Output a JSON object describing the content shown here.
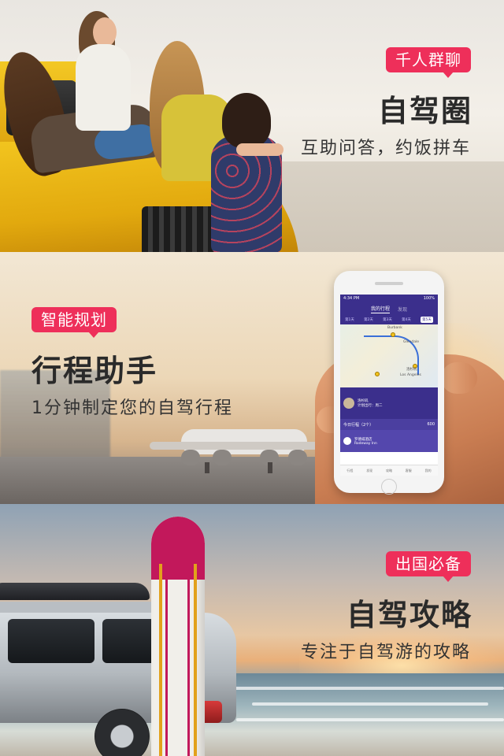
{
  "panels": [
    {
      "tag": "千人群聊",
      "title": "自驾圈",
      "subtitle": "互助问答，约饭拼车"
    },
    {
      "tag": "智能规划",
      "title": "行程助手",
      "subtitle": "1分钟制定您的自驾行程"
    },
    {
      "tag": "出国必备",
      "title": "自驾攻略",
      "subtitle": "专注于自驾游的攻略"
    }
  ],
  "phone": {
    "status_time": "4:34 PM",
    "status_battery": "100%",
    "tabs": [
      "我的行程",
      "发现"
    ],
    "days": [
      "第1天",
      "第2天",
      "第3天",
      "第4天",
      "第5天"
    ],
    "active_day": "第5天",
    "map_labels": [
      "Burbank",
      "Glendale",
      "Los Angeles",
      "洛杉矶"
    ],
    "card_title": "洛杉矶",
    "card_sub": "计划出行：周二",
    "section_label": "今日行程（2个）",
    "section_right": "600",
    "item_title": "罗德威酒店",
    "item_sub": "Rodeway Inn",
    "tabbar": [
      "行程",
      "发现",
      "攻略",
      "客服",
      "我的"
    ]
  },
  "colors": {
    "tag_bg": "#ee2f5a",
    "phone_theme": "#3b2f8c"
  }
}
